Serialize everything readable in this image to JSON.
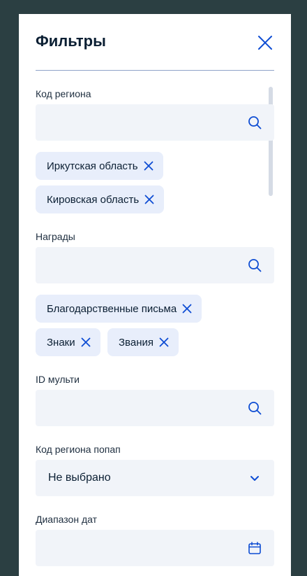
{
  "header": {
    "title": "Фильтры",
    "close_icon": "close-icon"
  },
  "filters": {
    "region_code": {
      "label": "Код региона",
      "value": "",
      "icon": "search-icon",
      "chips": [
        "Иркутская область",
        "Кировская область"
      ]
    },
    "awards": {
      "label": "Награды",
      "value": "",
      "icon": "search-icon",
      "chips": [
        "Благодарственные письма",
        "Знаки",
        "Звания"
      ]
    },
    "id_multi": {
      "label": "ID мульти",
      "value": "",
      "icon": "search-icon"
    },
    "region_code_popup": {
      "label": "Код региона попап",
      "selected": "Не выбрано",
      "icon": "chevron-down-icon"
    },
    "date_range": {
      "label": "Диапазон дат",
      "value": "",
      "icon": "calendar-icon"
    }
  },
  "colors": {
    "backdrop": "#2b3f42",
    "panel": "#ffffff",
    "field_bg": "#f1f4f9",
    "chip_bg": "#e8eefb",
    "accent": "#0d4cd3"
  }
}
